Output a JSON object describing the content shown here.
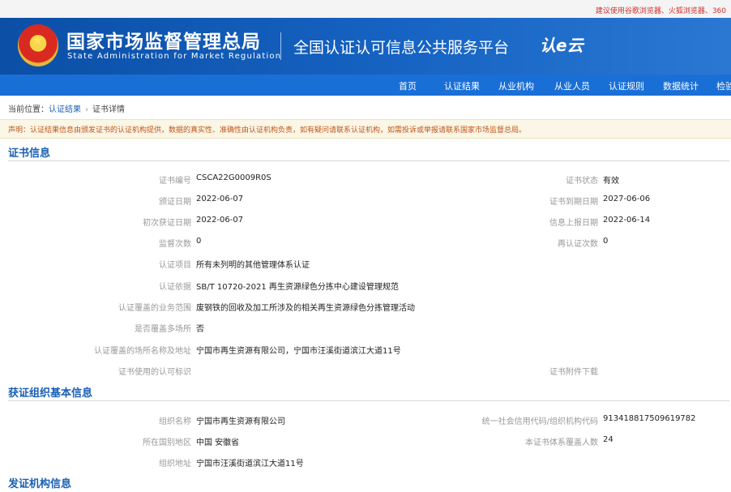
{
  "browser_tip": "建议使用谷歌浏览器、火狐浏览器、360",
  "header": {
    "org_cn": "国家市场监督管理总局",
    "org_en": "State Administration for Market Regulation",
    "platform_title": "全国认证认可信息公共服务平台",
    "logo_mark": "认e云"
  },
  "nav": [
    "首页",
    "认证结果",
    "从业机构",
    "从业人员",
    "认证规则",
    "数据统计",
    "检验"
  ],
  "breadcrumb": {
    "label": "当前位置：",
    "items": [
      "认证结果",
      "证书详情"
    ]
  },
  "notice": "声明：认证结果信息由颁发证书的认证机构提供，数据的真实性、准确性由认证机构负责，如有疑问请联系认证机构，如需投诉或举报请联系国家市场监督总局。",
  "cert_section": {
    "title": "证书信息",
    "rows": [
      {
        "label": "证书编号",
        "value": "CSCA22G0009R0S"
      },
      {
        "label": "颁证日期",
        "value": "2022-06-07"
      },
      {
        "label": "初次获证日期",
        "value": "2022-06-07"
      },
      {
        "label": "监督次数",
        "value": "0"
      },
      {
        "label": "认证项目",
        "value": "所有未列明的其他管理体系认证"
      },
      {
        "label": "认证依据",
        "value": "SB/T 10720-2021 再生资源绿色分拣中心建设管理规范"
      },
      {
        "label": "认证覆盖的业务范围",
        "value": "废钢铁的回收及加工所涉及的相关再生资源绿色分拣管理活动"
      },
      {
        "label": "是否覆盖多场所",
        "value": "否"
      },
      {
        "label": "认证覆盖的场所名称及地址",
        "value": "宁国市再生资源有限公司，宁国市汪溪街道滨江大道11号"
      },
      {
        "label": "证书使用的认可标识",
        "value": ""
      }
    ],
    "right_rows": [
      {
        "label": "证书状态",
        "value": "有效"
      },
      {
        "label": "证书到期日期",
        "value": "2027-06-06"
      },
      {
        "label": "信息上报日期",
        "value": "2022-06-14"
      },
      {
        "label": "再认证次数",
        "value": "0"
      }
    ],
    "attachment_label": "证书附件下载"
  },
  "org_section": {
    "title": "获证组织基本信息",
    "rows": [
      {
        "label": "组织名称",
        "value": "宁国市再生资源有限公司"
      },
      {
        "label": "所在国别地区",
        "value": "中国 安徽省"
      },
      {
        "label": "组织地址",
        "value": "宁国市汪溪街道滨江大道11号"
      }
    ],
    "right_rows": [
      {
        "label": "统一社会信用代码/组织机构代码",
        "value": "913418817509619782"
      },
      {
        "label": "本证书体系覆盖人数",
        "value": "24"
      }
    ]
  },
  "issuer_section": {
    "title": "发证机构信息"
  }
}
